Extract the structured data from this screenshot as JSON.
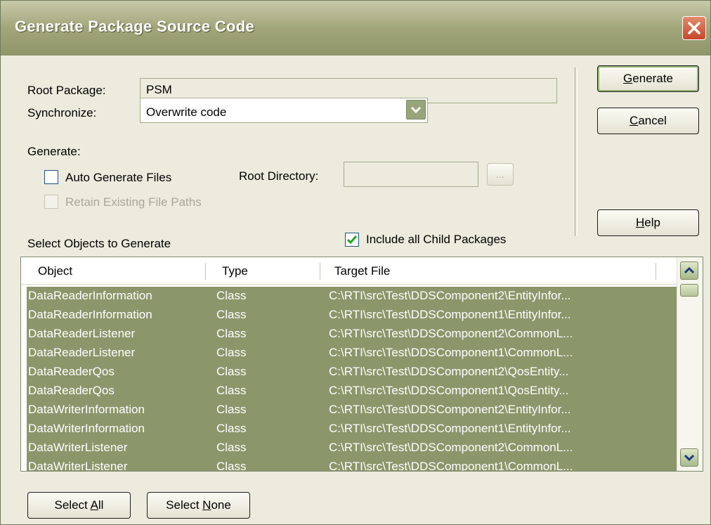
{
  "window": {
    "title": "Generate Package Source Code"
  },
  "form": {
    "root_package_label": "Root Package:",
    "root_package_value": "PSM",
    "synchronize_label": "Synchronize:",
    "synchronize_value": "Overwrite code",
    "generate_label": "Generate:",
    "auto_generate_label": "Auto Generate Files",
    "auto_generate_checked": false,
    "root_directory_label": "Root Directory:",
    "root_directory_value": "",
    "browse_label": "...",
    "retain_paths_label": "Retain Existing File Paths",
    "retain_paths_checked": false,
    "select_objects_label": "Select Objects to Generate",
    "include_children_label": "Include all Child Packages",
    "include_children_checked": true
  },
  "buttons": {
    "generate": {
      "pre": "",
      "accel": "G",
      "post": "enerate"
    },
    "cancel": {
      "pre": "",
      "accel": "C",
      "post": "ancel"
    },
    "help": {
      "pre": "",
      "accel": "H",
      "post": "elp"
    },
    "select_all": {
      "pre": "Select ",
      "accel": "A",
      "post": "ll"
    },
    "select_none": {
      "pre": "Select ",
      "accel": "N",
      "post": "one"
    }
  },
  "table": {
    "columns": [
      "Object",
      "Type",
      "Target File"
    ],
    "rows": [
      [
        "DataReaderInformation",
        "Class",
        "C:\\RTI\\src\\Test\\DDSComponent2\\EntityInfor..."
      ],
      [
        "DataReaderInformation",
        "Class",
        "C:\\RTI\\src\\Test\\DDSComponent1\\EntityInfor..."
      ],
      [
        "DataReaderListener",
        "Class",
        "C:\\RTI\\src\\Test\\DDSComponent2\\CommonL..."
      ],
      [
        "DataReaderListener",
        "Class",
        "C:\\RTI\\src\\Test\\DDSComponent1\\CommonL..."
      ],
      [
        "DataReaderQos",
        "Class",
        "C:\\RTI\\src\\Test\\DDSComponent2\\QosEntity..."
      ],
      [
        "DataReaderQos",
        "Class",
        "C:\\RTI\\src\\Test\\DDSComponent1\\QosEntity..."
      ],
      [
        "DataWriterInformation",
        "Class",
        "C:\\RTI\\src\\Test\\DDSComponent2\\EntityInfor..."
      ],
      [
        "DataWriterInformation",
        "Class",
        "C:\\RTI\\src\\Test\\DDSComponent1\\EntityInfor..."
      ],
      [
        "DataWriterListener",
        "Class",
        "C:\\RTI\\src\\Test\\DDSComponent2\\CommonL..."
      ],
      [
        "DataWriterListener",
        "Class",
        "C:\\RTI\\src\\Test\\DDSComponent1\\CommonL..."
      ]
    ]
  },
  "icons": {
    "close": "close-icon",
    "dropdown": "chevron-down-icon",
    "scroll_up": "chevron-up-icon",
    "scroll_down": "chevron-down-icon",
    "checkmark": "checkmark-icon"
  },
  "colors": {
    "title_bar": "#a2a67a",
    "selection": "#8b966b",
    "close": "#c6462a",
    "check": "#21a121"
  }
}
